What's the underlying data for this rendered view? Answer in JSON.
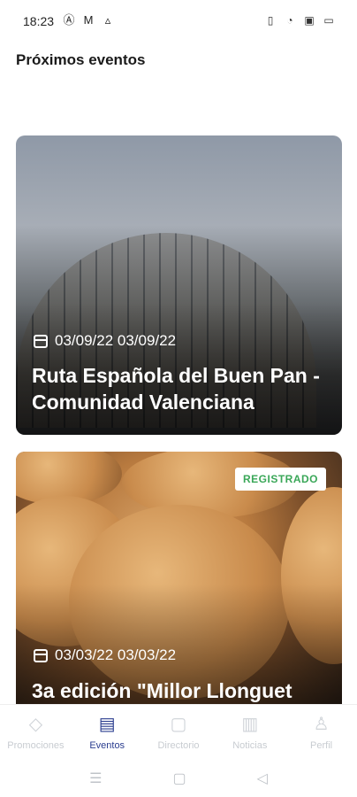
{
  "status": {
    "time": "18:23",
    "left_icons": [
      "app-a-icon",
      "gmail-icon",
      "drive-icon"
    ],
    "right_icons": [
      "vibrate-icon",
      "wifi-icon",
      "screen-icon",
      "battery-icon"
    ]
  },
  "page": {
    "title": "Próximos eventos"
  },
  "events": [
    {
      "date": "03/09/22 03/09/22",
      "title": "Ruta Española del Buen Pan - Comunidad Valenciana",
      "badge": ""
    },
    {
      "date": "03/03/22 03/03/22",
      "title": "3a edición \"Millor Llonguet",
      "badge": "REGISTRADO"
    }
  ],
  "nav": {
    "tabs": [
      {
        "label": "Promociones",
        "icon": "tag-icon",
        "active": false
      },
      {
        "label": "Eventos",
        "icon": "calendar-list-icon",
        "active": true
      },
      {
        "label": "Directorio",
        "icon": "directory-search-icon",
        "active": false
      },
      {
        "label": "Noticias",
        "icon": "news-icon",
        "active": false
      },
      {
        "label": "Perfil",
        "icon": "user-icon",
        "active": false
      }
    ]
  },
  "system_nav": [
    "menu-icon",
    "home-icon",
    "back-icon"
  ]
}
